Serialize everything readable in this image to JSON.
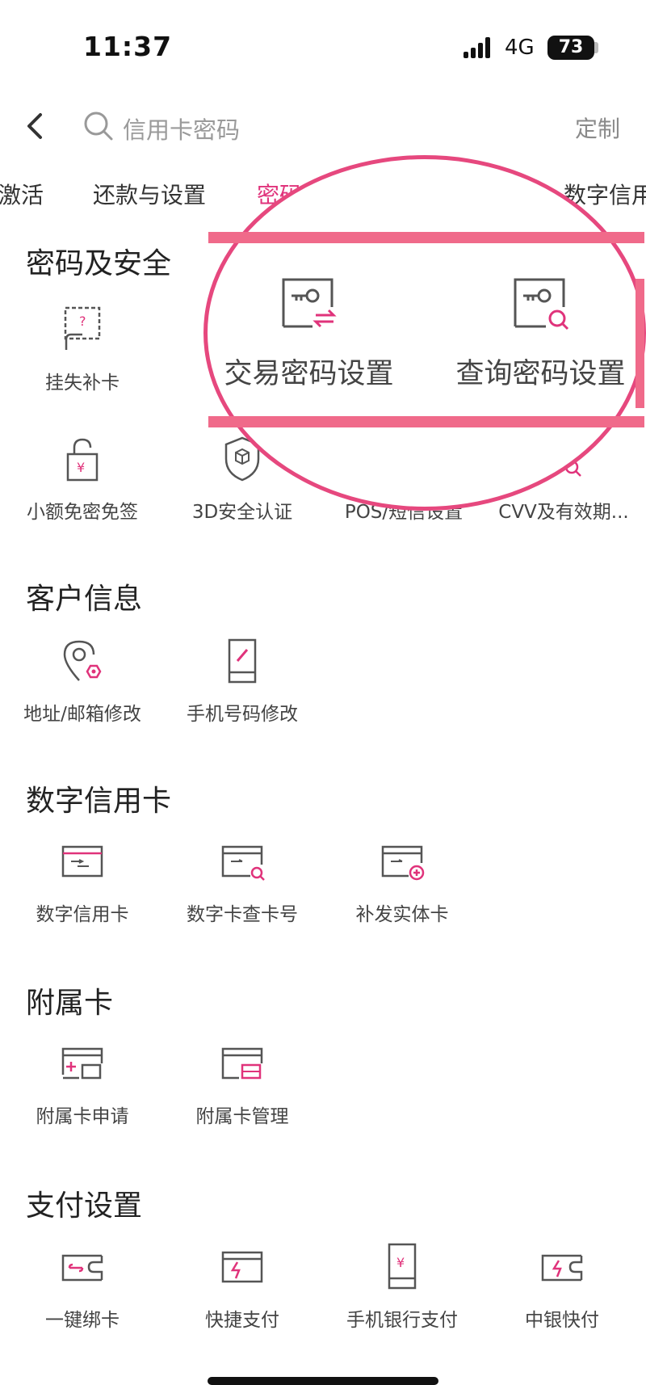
{
  "status": {
    "time": "11:37",
    "network": "4G",
    "battery": "73"
  },
  "search": {
    "placeholder": "信用卡密码",
    "customize": "定制"
  },
  "tabs": [
    {
      "label": "激活"
    },
    {
      "label": "还款与设置"
    },
    {
      "label": "密码"
    },
    {
      "label": "数字信用"
    }
  ],
  "sections": [
    {
      "title": "密码及安全",
      "items": [
        {
          "label": "挂失补卡",
          "icon": "lost-card-icon"
        },
        {
          "label": "小额免密免签",
          "icon": "lock-yen-icon"
        },
        {
          "label": "3D安全认证",
          "icon": "shield-cube-icon"
        },
        {
          "label": "POS/短信设置",
          "icon": "pos-icon"
        },
        {
          "label": "CVV及有效期...",
          "icon": "cvv-search-icon"
        }
      ]
    },
    {
      "title": "客户信息",
      "items": [
        {
          "label": "地址/邮箱修改",
          "icon": "location-gear-icon"
        },
        {
          "label": "手机号码修改",
          "icon": "phone-edit-icon"
        }
      ]
    },
    {
      "title": "数字信用卡",
      "items": [
        {
          "label": "数字信用卡",
          "icon": "digital-card-icon"
        },
        {
          "label": "数字卡查卡号",
          "icon": "card-search-icon"
        },
        {
          "label": "补发实体卡",
          "icon": "card-add-icon"
        }
      ]
    },
    {
      "title": "附属卡",
      "items": [
        {
          "label": "附属卡申请",
          "icon": "sub-card-apply-icon"
        },
        {
          "label": "附属卡管理",
          "icon": "sub-card-manage-icon"
        }
      ]
    },
    {
      "title": "支付设置",
      "items": [
        {
          "label": "一键绑卡",
          "icon": "wallet-link-icon"
        },
        {
          "label": "快捷支付",
          "icon": "card-flash-icon"
        },
        {
          "label": "手机银行支付",
          "icon": "phone-yen-icon"
        },
        {
          "label": "中银快付",
          "icon": "wallet-flash-icon"
        }
      ]
    }
  ],
  "zoom": {
    "items": [
      {
        "label": "交易密码设置",
        "icon": "key-exchange-icon"
      },
      {
        "label": "查询密码设置",
        "icon": "key-search-icon"
      }
    ]
  },
  "colors": {
    "accent": "#e0337b",
    "highlight": "#e6487e"
  }
}
